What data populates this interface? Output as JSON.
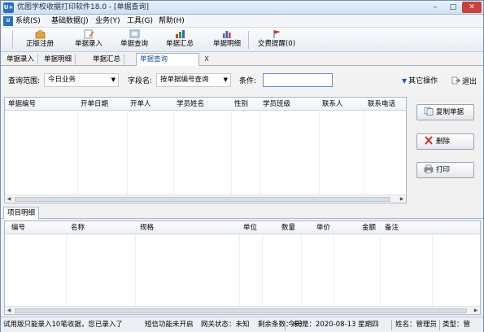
{
  "window": {
    "title": "优图学校收据打印软件18.0 - [单据查询]",
    "app_icon_text": "U+",
    "minimize": "–",
    "maximize": "□",
    "close": "✕"
  },
  "menu": {
    "items": [
      "系统(S)",
      "基础数据(J)",
      "业务(Y)",
      "工具(G)",
      "帮助(H)"
    ]
  },
  "toolbar": {
    "buttons": [
      "正版注册",
      "单据录入",
      "单据查询",
      "单据汇总",
      "单据明细",
      "交费提醒(0)"
    ]
  },
  "doc_tabs": {
    "items": [
      "单据录入",
      "单据明细",
      "单据汇总",
      "单据查询"
    ],
    "active_index": 3,
    "close": "X"
  },
  "query": {
    "range_label": "查询范围:",
    "range_value": "今日业务",
    "field_label": "字段名:",
    "field_value": "按单据编号查询",
    "condition_label": "条件:",
    "condition_value": "",
    "other_ops": "其它操作",
    "exit": "退出"
  },
  "main_table": {
    "columns": [
      "单据编号",
      "开单日期",
      "开单人",
      "学员姓名",
      "性别",
      "学员班级",
      "联系人",
      "联系电话"
    ],
    "rows": []
  },
  "actions": {
    "copy": "复制单据",
    "delete": "删除",
    "print": "打印"
  },
  "detail": {
    "tab_label": "项目明细",
    "columns": [
      "编号",
      "名称",
      "规格",
      "单位",
      "数量",
      "单价",
      "金额",
      "备注"
    ],
    "rows": []
  },
  "status": {
    "trial": "试用版只能录入10笔收据，您已录入了",
    "sms": "短信功能未开启",
    "gateway": "网关状态：未知",
    "remaining": "剩余条数：未知",
    "today": "今天是：2020-08-13 星期四",
    "name": "姓名：管理员",
    "type": "类型：管"
  },
  "colors": {
    "accent": "#1d4fa3",
    "close_button": "#c8423a",
    "border": "#a9b8cb"
  }
}
